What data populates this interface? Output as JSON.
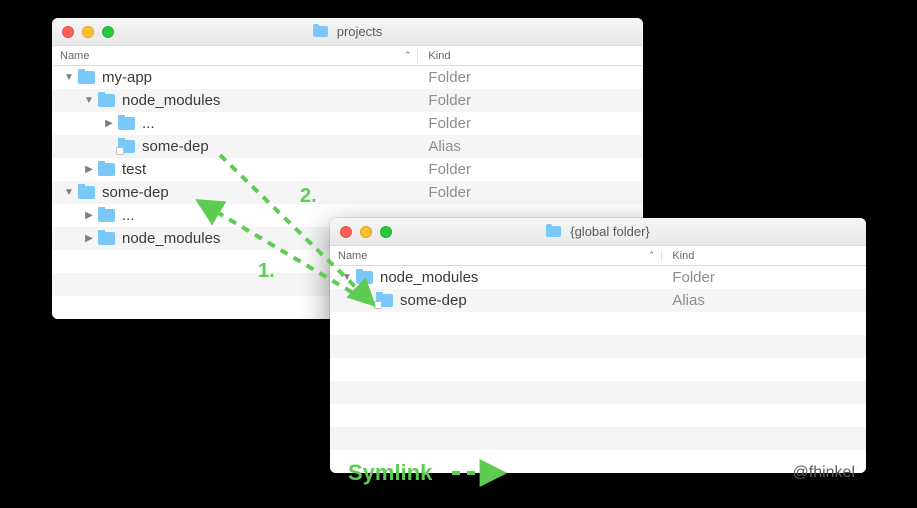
{
  "windows": {
    "projects": {
      "title": "projects",
      "columns": {
        "name": "Name",
        "kind": "Kind"
      },
      "rows": [
        {
          "indent": 0,
          "disclosure": "▼",
          "icon": "folder",
          "label": "my-app",
          "kind": "Folder"
        },
        {
          "indent": 1,
          "disclosure": "▼",
          "icon": "folder",
          "label": "node_modules",
          "kind": "Folder"
        },
        {
          "indent": 2,
          "disclosure": "▶",
          "icon": "folder",
          "label": "...",
          "kind": "Folder"
        },
        {
          "indent": 2,
          "disclosure": "",
          "icon": "alias",
          "label": "some-dep",
          "kind": "Alias"
        },
        {
          "indent": 1,
          "disclosure": "▶",
          "icon": "folder",
          "label": "test",
          "kind": "Folder"
        },
        {
          "indent": 0,
          "disclosure": "▼",
          "icon": "folder",
          "label": "some-dep",
          "kind": "Folder"
        },
        {
          "indent": 1,
          "disclosure": "▶",
          "icon": "folder",
          "label": "...",
          "kind": ""
        },
        {
          "indent": 1,
          "disclosure": "▶",
          "icon": "folder",
          "label": "node_modules",
          "kind": ""
        }
      ],
      "pad_rows": 3
    },
    "global": {
      "title": "{global folder}",
      "columns": {
        "name": "Name",
        "kind": "Kind"
      },
      "rows": [
        {
          "indent": 0,
          "disclosure": "▼",
          "icon": "folder",
          "label": "node_modules",
          "kind": "Folder"
        },
        {
          "indent": 1,
          "disclosure": "",
          "icon": "alias",
          "label": "some-dep",
          "kind": "Alias"
        }
      ],
      "pad_rows": 7
    }
  },
  "annotations": {
    "one": "1.",
    "two": "2.",
    "legend": "Symlink",
    "credit": "@fhinkel"
  }
}
